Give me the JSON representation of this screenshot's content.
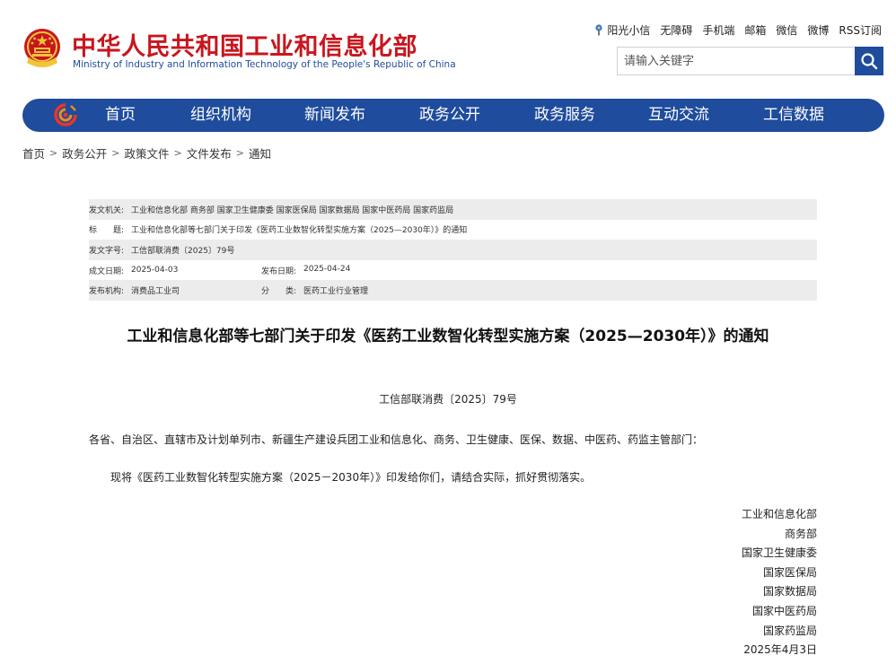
{
  "header": {
    "title": "中华人民共和国工业和信息化部",
    "subtitle": "Ministry of Industry and Information Technology of the People's Republic of China",
    "links": [
      "阳光小信",
      "无障碍",
      "手机端",
      "邮箱",
      "微信",
      "微博",
      "RSS订阅"
    ],
    "search_placeholder": "请输入关键字"
  },
  "nav": {
    "items": [
      "首页",
      "组织机构",
      "新闻发布",
      "政务公开",
      "政务服务",
      "互动交流",
      "工信数据"
    ]
  },
  "breadcrumb": [
    "首页",
    "政务公开",
    "政策文件",
    "文件发布",
    "通知"
  ],
  "meta": {
    "issuer_label": "发文机关:",
    "issuer_value": "工业和信息化部 商务部 国家卫生健康委 国家医保局 国家数据局 国家中医药局 国家药监局",
    "title_label": "标　　题:",
    "title_value": "工业和信息化部等七部门关于印发《医药工业数智化转型实施方案（2025—2030年）》的通知",
    "docno_label": "发文字号:",
    "docno_value": "工信部联消费〔2025〕79号",
    "created_label": "成文日期:",
    "created_value": "2025-04-03",
    "published_label": "发布日期:",
    "published_value": "2025-04-24",
    "agency_label": "发布机构:",
    "agency_value": "消费品工业司",
    "category_label": "分　　类:",
    "category_value": "医药工业行业管理"
  },
  "doc": {
    "title": "工业和信息化部等七部门关于印发《医药工业数智化转型实施方案（2025—2030年）》的通知",
    "number": "工信部联消费〔2025〕79号",
    "addressee": "各省、自治区、直辖市及计划单列市、新疆生产建设兵团工业和信息化、商务、卫生健康、医保、数据、中医药、药监主管部门：",
    "body": "现将《医药工业数智化转型实施方案（2025－2030年）》印发给你们，请结合实际，抓好贯彻落实。",
    "signatures": [
      "工业和信息化部",
      "商务部",
      "国家卫生健康委",
      "国家医保局",
      "国家数据局",
      "国家中医药局",
      "国家药监局",
      "2025年4月3日"
    ]
  },
  "colors": {
    "brand_red": "#c8161e",
    "brand_blue": "#1f4c9c",
    "meta_shade": "#ececec"
  }
}
